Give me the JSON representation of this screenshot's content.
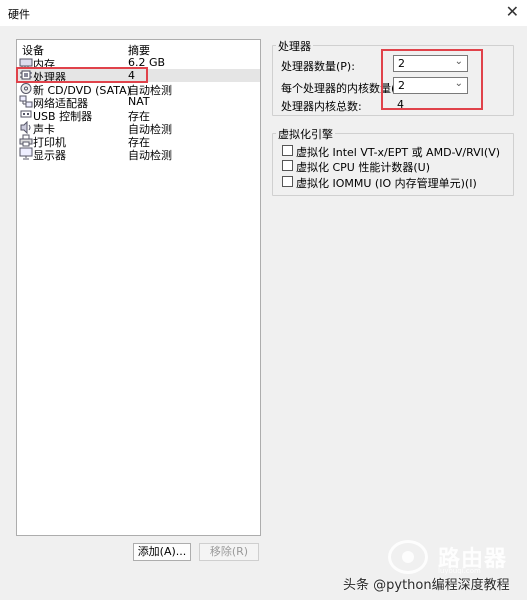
{
  "window": {
    "title": "硬件",
    "close_glyph": "✕"
  },
  "device_list": {
    "headers": {
      "device": "设备",
      "summary": "摘要"
    },
    "items": [
      {
        "name": "内存",
        "summary": "6.2 GB",
        "icon": "memory-icon"
      },
      {
        "name": "处理器",
        "summary": "4",
        "icon": "processor-icon",
        "selected": true
      },
      {
        "name": "新 CD/DVD (SATA)",
        "summary": "自动检测",
        "icon": "cd-dvd-icon"
      },
      {
        "name": "网络适配器",
        "summary": "NAT",
        "icon": "network-adapter-icon"
      },
      {
        "name": "USB 控制器",
        "summary": "存在",
        "icon": "usb-icon"
      },
      {
        "name": "声卡",
        "summary": "自动检测",
        "icon": "sound-icon"
      },
      {
        "name": "打印机",
        "summary": "存在",
        "icon": "printer-icon"
      },
      {
        "name": "显示器",
        "summary": "自动检测",
        "icon": "display-icon"
      }
    ]
  },
  "buttons": {
    "add": "添加(A)...",
    "remove": "移除(R)"
  },
  "processor": {
    "group_title": "处理器",
    "count_label": "处理器数量(P):",
    "count_value": "2",
    "cores_label": "每个处理器的内核数量(C):",
    "cores_value": "2",
    "total_label": "处理器内核总数:",
    "total_value": "4"
  },
  "virtualization": {
    "group_title": "虚拟化引擎",
    "options": [
      {
        "label": "虚拟化 Intel VT-x/EPT 或 AMD-V/RVI(V)",
        "checked": false
      },
      {
        "label": "虚拟化 CPU 性能计数器(U)",
        "checked": false
      },
      {
        "label": "虚拟化 IOMMU (IO 内存管理单元)(I)",
        "checked": false
      }
    ]
  },
  "watermark": {
    "logo_title": "路由器",
    "logo_url": "luyouqi.com",
    "credit": "头条 @python编程深度教程"
  },
  "colors": {
    "highlight_red": "#e0424a",
    "selected_row": "#e5e5e5"
  }
}
